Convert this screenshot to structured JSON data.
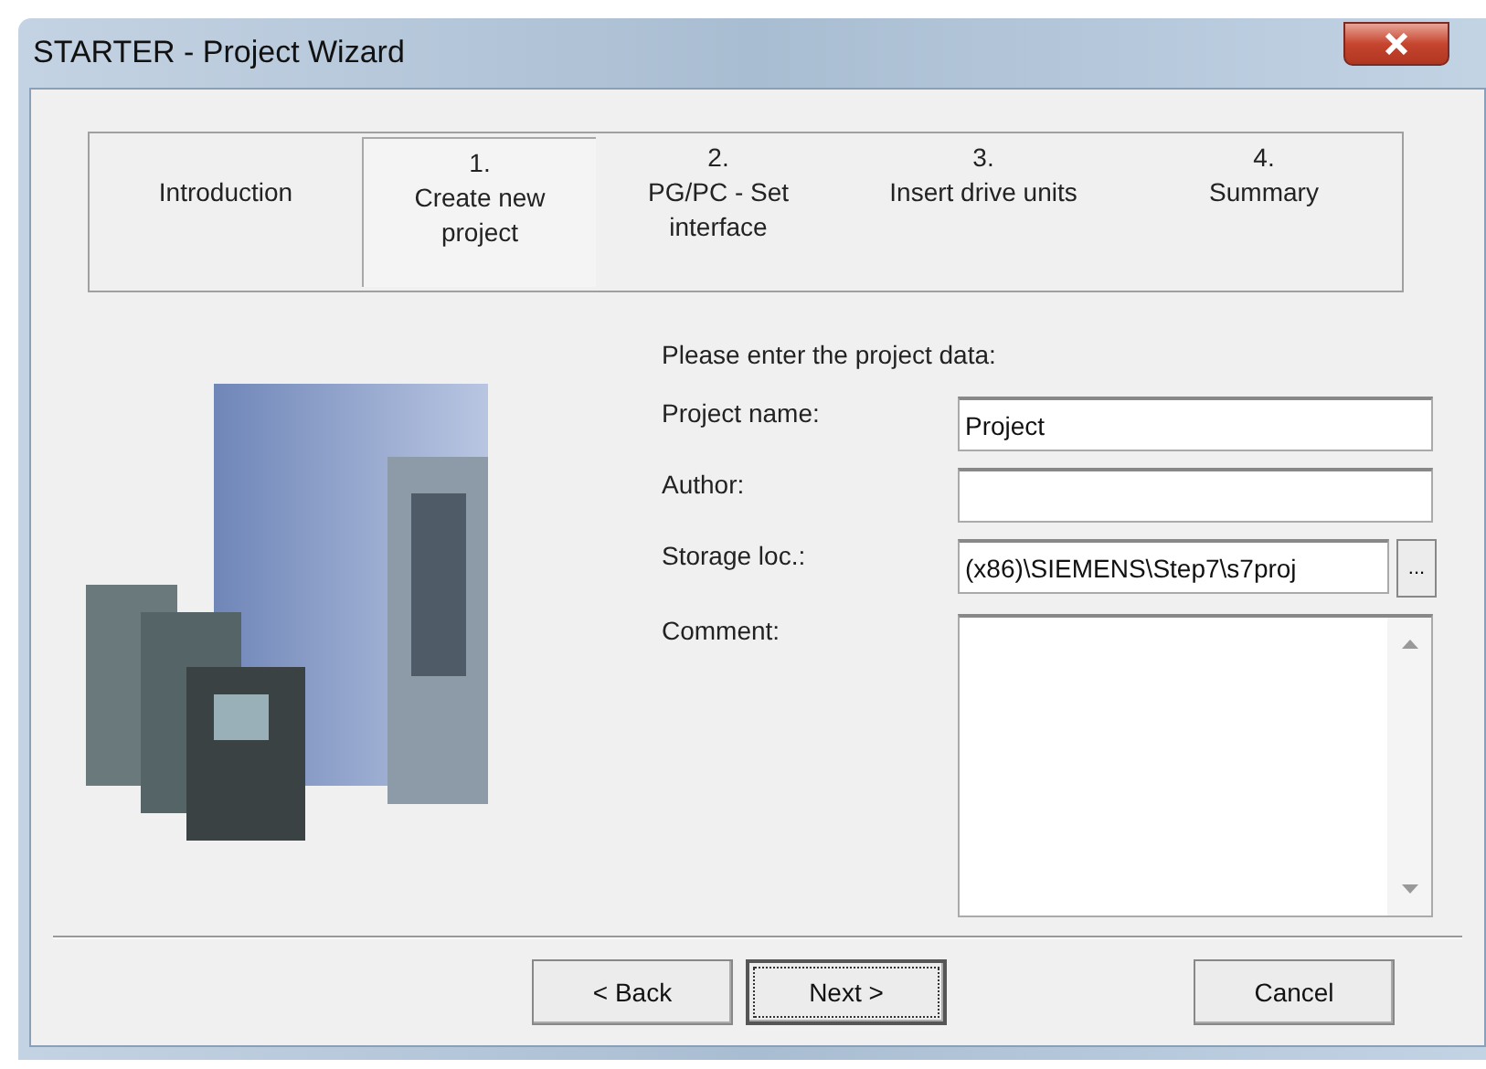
{
  "window": {
    "title": "STARTER - Project Wizard"
  },
  "steps": [
    {
      "label": "Introduction",
      "selected": false
    },
    {
      "number": "1.",
      "label": "Create new project",
      "selected": true
    },
    {
      "number": "2.",
      "label": "PG/PC - Set interface",
      "selected": false
    },
    {
      "number": "3.",
      "label": "Insert drive units",
      "selected": false
    },
    {
      "number": "4.",
      "label": "Summary",
      "selected": false
    }
  ],
  "form": {
    "heading": "Please enter the project data:",
    "fields": [
      {
        "kind": "text",
        "label": "Project name:",
        "value": "Project"
      },
      {
        "kind": "text",
        "label": "Author:"
      },
      {
        "kind": "path",
        "label": "Storage loc.:",
        "value": "(x86)\\SIEMENS\\Step7\\s7proj",
        "browse": "..."
      },
      {
        "kind": "textarea",
        "label": "Comment:"
      }
    ]
  },
  "buttons": [
    {
      "label": "< Back",
      "focused": false
    },
    {
      "label": "Next >",
      "focused": true
    },
    {
      "label": "Cancel",
      "focused": false
    }
  ]
}
